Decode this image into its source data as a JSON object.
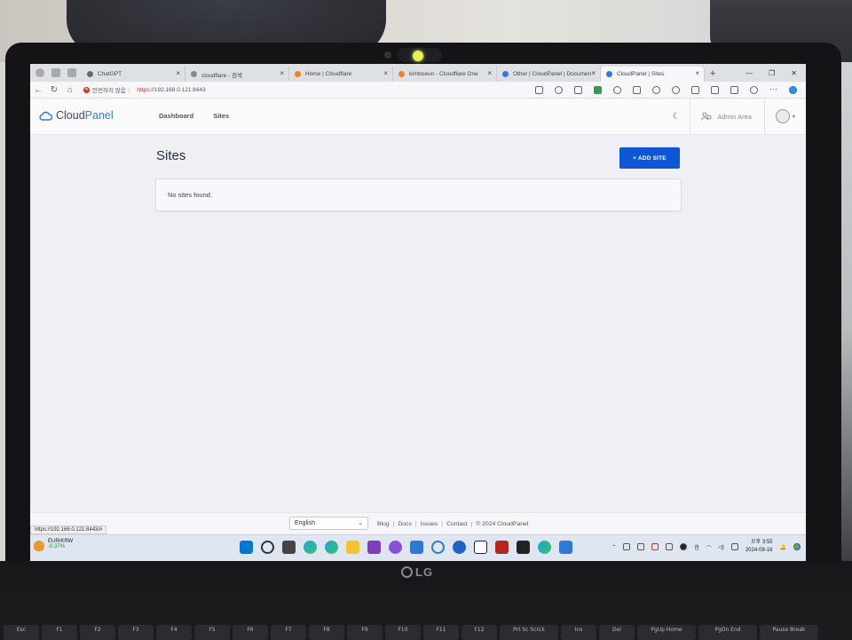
{
  "browser": {
    "tabs": [
      {
        "label": "ChatGPT",
        "favicon_color": "#6b6b6b"
      },
      {
        "label": "cloudflare - 검색",
        "favicon_color": "#888888"
      },
      {
        "label": "Home | Cloudflare",
        "favicon_color": "#f38020"
      },
      {
        "label": "kimboeun - Cloudflare One",
        "favicon_color": "#f38020"
      },
      {
        "label": "Other | CloudPanel | Documen",
        "favicon_color": "#2f7be6"
      },
      {
        "label": "CloudPanel | Sites",
        "favicon_color": "#2f7be6",
        "active": true
      }
    ],
    "new_tab_symbol": "+",
    "security_label": "안전하지 않음",
    "url_scheme": "https",
    "url_rest": "://192.168.0.121:8443",
    "status_url": "https://192.168.0.121:8443/#"
  },
  "app": {
    "brand_part1": "Cloud",
    "brand_part2": "Panel",
    "nav": [
      "Dashboard",
      "Sites"
    ],
    "admin_area": "Admin Area",
    "page_title": "Sites",
    "add_button": "+ ADD SITE",
    "empty_message": "No sites found.",
    "accent_color": "#0d57d6"
  },
  "footer": {
    "language": "English",
    "links": [
      "Blog",
      "Docs",
      "Issues",
      "Contact"
    ],
    "copyright": "© 2024  CloudPanel"
  },
  "taskbar": {
    "ticker": "EUR/KRW",
    "ticker_change": "-0.37%",
    "time_label": "오후",
    "time": "3:55",
    "date": "2024-08-16"
  },
  "laptop": {
    "brand": "LG",
    "keys": [
      "Esc",
      "F1",
      "F2",
      "F3",
      "F4",
      "F5",
      "F6",
      "F7",
      "F8",
      "F9",
      "F10",
      "F11",
      "F12",
      "Prt Sc ScrLk",
      "Ins",
      "Del",
      "PgUp Home",
      "PgDn End",
      "Pause Break"
    ]
  }
}
